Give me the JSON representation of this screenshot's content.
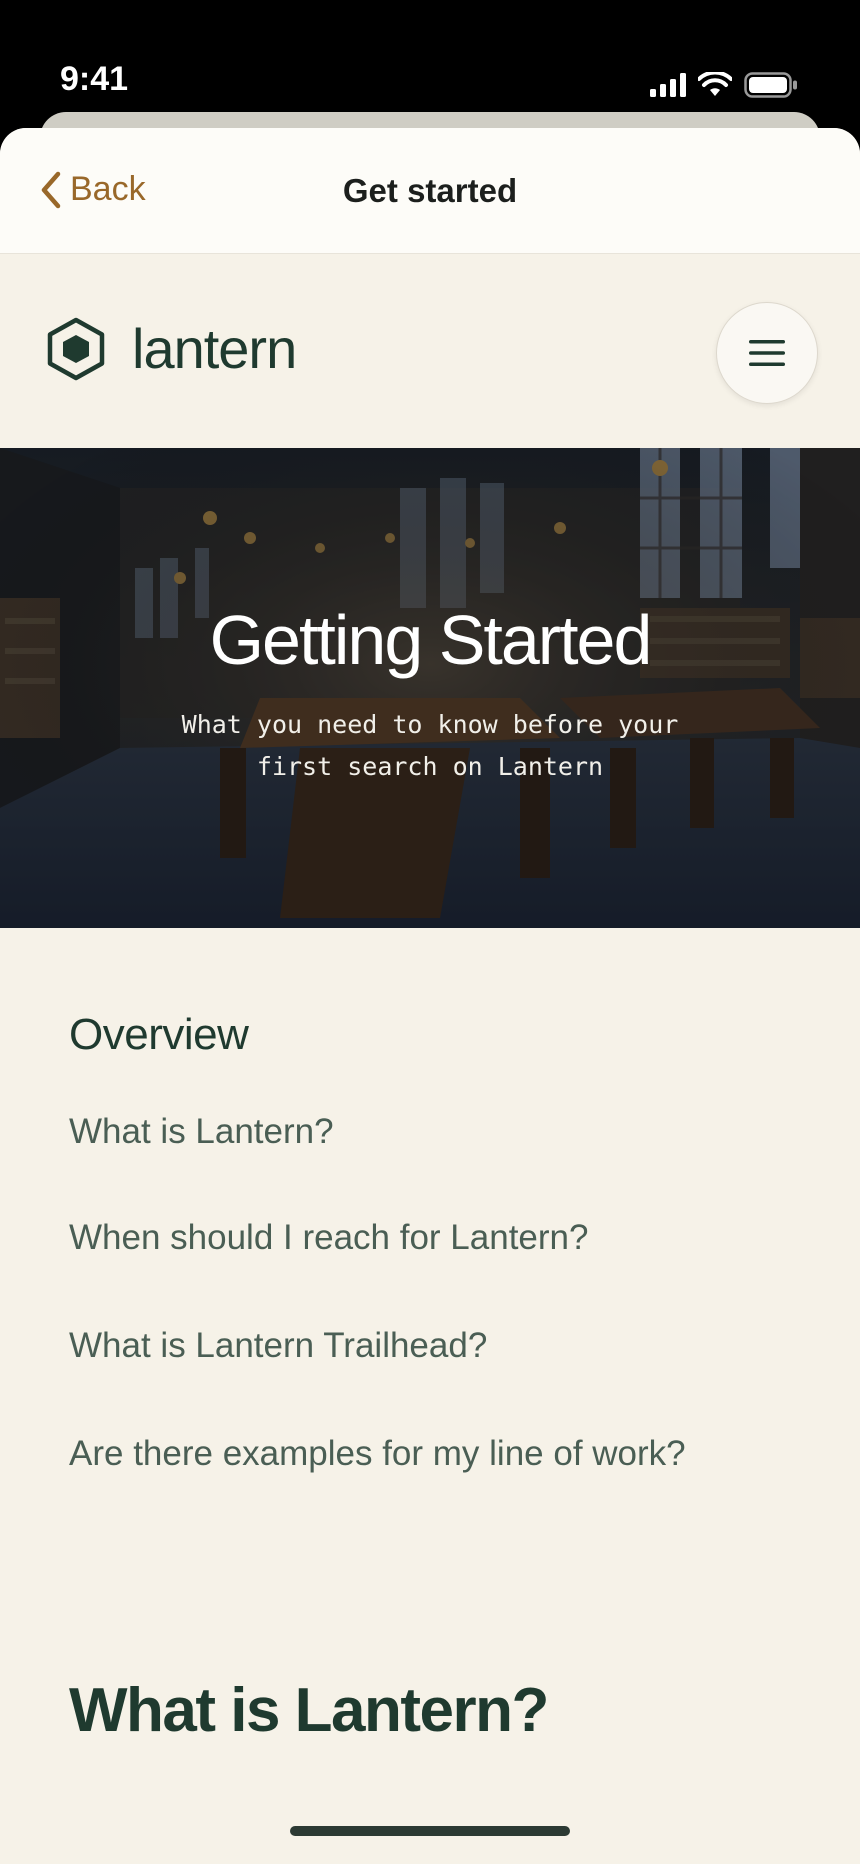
{
  "status_bar": {
    "time": "9:41"
  },
  "nav": {
    "back_label": "Back",
    "title": "Get started"
  },
  "brand": {
    "name": "lantern"
  },
  "hero": {
    "title": "Getting Started",
    "subtitle": "What you need to know before your first search on Lantern"
  },
  "overview": {
    "heading": "Overview",
    "items": [
      "What is Lantern?",
      "When should I reach for Lantern?",
      "What is Lantern Trailhead?",
      "Are there examples for my line of work?"
    ]
  },
  "section": {
    "heading": "What is Lantern?"
  },
  "colors": {
    "accent": "#99682a",
    "brand": "#1f3a2f",
    "background": "#f6f2e8"
  },
  "icons": [
    "chevron-left-icon",
    "hexagon-logo-icon",
    "hamburger-menu-icon",
    "signal-icon",
    "wifi-icon",
    "battery-icon"
  ]
}
